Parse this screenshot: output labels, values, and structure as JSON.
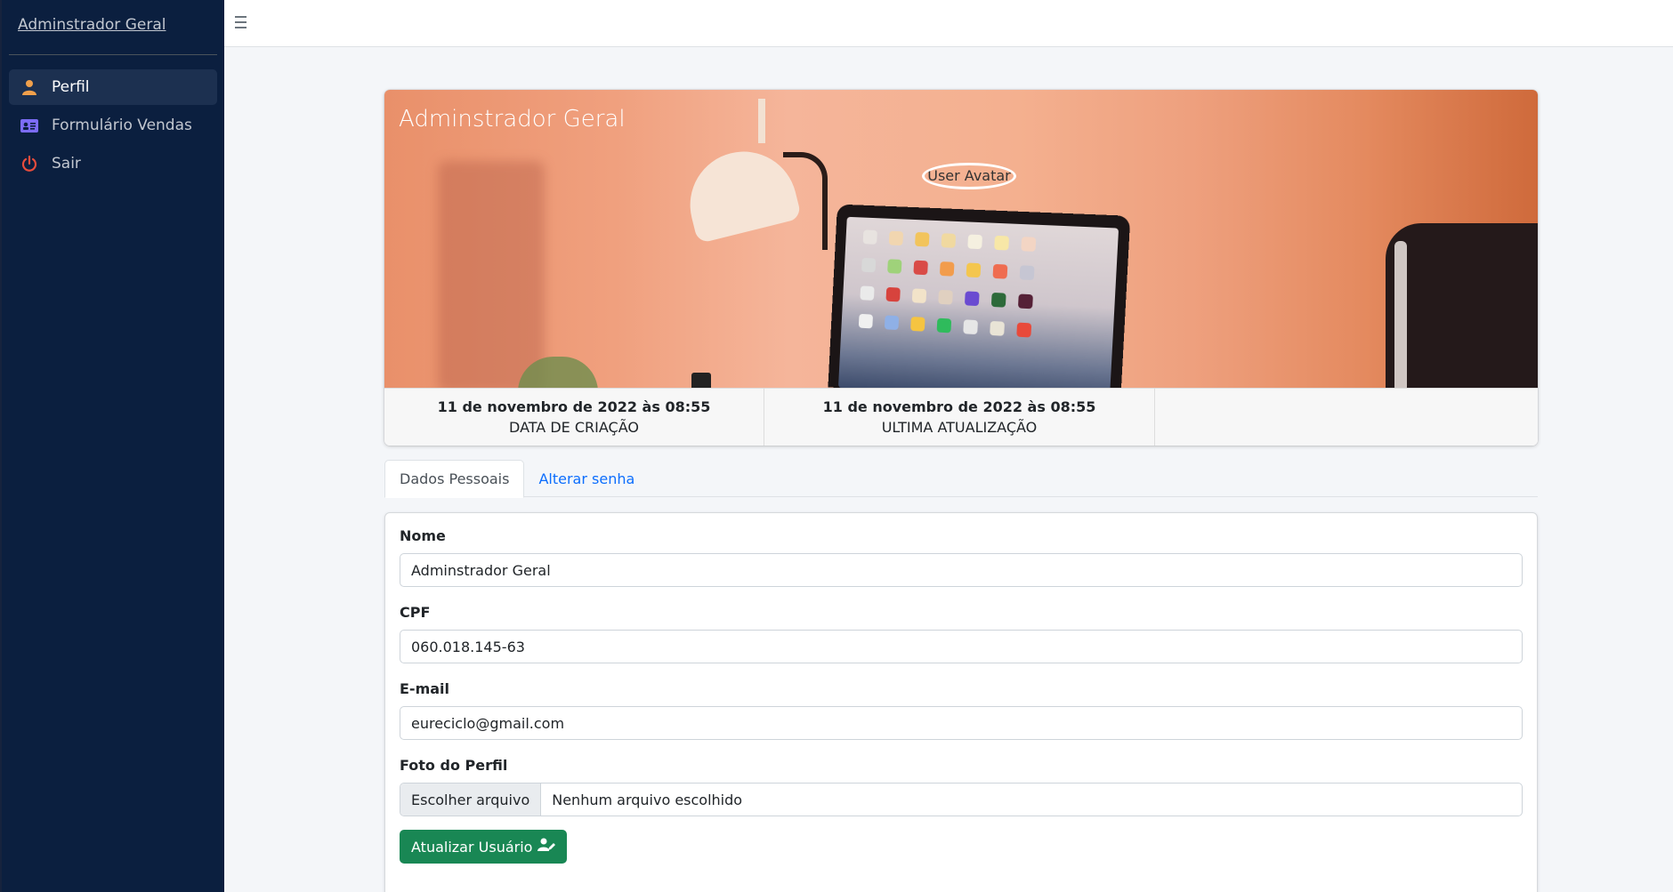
{
  "sidebar": {
    "brand": "Adminstrador Geral",
    "items": [
      {
        "label": "Perfil",
        "icon": "user-icon",
        "color": "#f0a04b"
      },
      {
        "label": "Formulário Vendas",
        "icon": "id-card-icon",
        "color": "#7c6cf5"
      },
      {
        "label": "Sair",
        "icon": "power-icon",
        "color": "#e74c3c"
      }
    ]
  },
  "profile": {
    "name": "Adminstrador Geral",
    "avatar_alt": "User Avatar",
    "stats": [
      {
        "value": "11 de novembro de 2022 às 08:55",
        "label": "DATA DE CRIAÇÃO"
      },
      {
        "value": "11 de novembro de 2022 às 08:55",
        "label": "ULTIMA ATUALIZAÇÃO"
      }
    ]
  },
  "tabs": [
    {
      "label": "Dados Pessoais",
      "active": true
    },
    {
      "label": "Alterar senha",
      "active": false
    }
  ],
  "form": {
    "nome_label": "Nome",
    "nome_value": "Adminstrador Geral",
    "cpf_label": "CPF",
    "cpf_value": "060.018.145-63",
    "email_label": "E-mail",
    "email_value": "eureciclo@gmail.com",
    "foto_label": "Foto do Perfil",
    "file_button": "Escolher arquivo",
    "file_status": "Nenhum arquivo escolhido",
    "submit_label": "Atualizar Usuário"
  },
  "colors": {
    "sidebar_bg": "#0b1f3f",
    "submit_bg": "#198754",
    "link": "#0d6efd"
  }
}
